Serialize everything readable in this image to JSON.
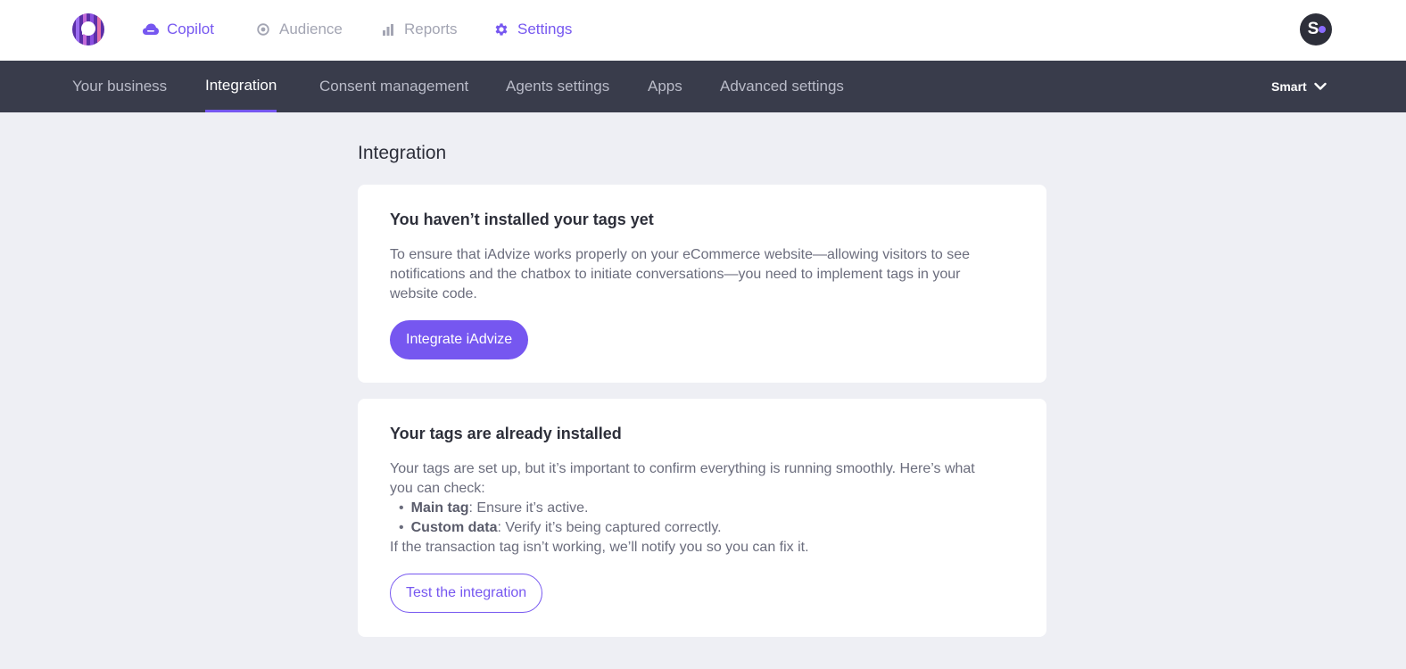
{
  "colors": {
    "accent": "#7657f0",
    "topbar_bg": "#ffffff",
    "subnav_bg": "#393c4b",
    "page_bg": "#eeeff4",
    "text_dark": "#2d2f3a",
    "text_muted": "#6b6d7d"
  },
  "topnav": {
    "items": [
      {
        "label": "Copilot",
        "icon": "cloud-icon",
        "active": true
      },
      {
        "label": "Audience",
        "icon": "target-icon",
        "active": false
      },
      {
        "label": "Reports",
        "icon": "bar-chart-icon",
        "active": false
      },
      {
        "label": "Settings",
        "icon": "gear-icon",
        "active": true
      }
    ],
    "avatar_initial": "S"
  },
  "subnav": {
    "items": [
      {
        "label": "Your business",
        "active": false
      },
      {
        "label": "Integration",
        "active": true
      },
      {
        "label": "Consent management",
        "active": false
      },
      {
        "label": "Agents settings",
        "active": false
      },
      {
        "label": "Apps",
        "active": false
      },
      {
        "label": "Advanced settings",
        "active": false
      }
    ],
    "workspace": "Smart"
  },
  "main": {
    "title": "Integration",
    "card_not_installed": {
      "heading": "You haven’t installed your tags yet",
      "body_line1": "To ensure that iAdvize works properly on your eCommerce website—allowing visitors to see",
      "body_line2": "notifications and the chatbox to initiate conversations—you need to implement tags in your",
      "body_line3": "website code.",
      "button": "Integrate iAdvize"
    },
    "card_installed": {
      "heading": "Your tags are already installed",
      "body_line1": "Your tags are set up, but it’s important to confirm everything is running smoothly. Here’s what",
      "body_line2": "you can check:",
      "bullets": [
        {
          "term": "Main tag",
          "text": ": Ensure it’s active."
        },
        {
          "term": "Custom data",
          "text": ": Verify it’s being captured correctly."
        }
      ],
      "footer": "If the transaction tag isn’t working, we’ll notify you so you can fix it.",
      "button": "Test the integration"
    }
  }
}
